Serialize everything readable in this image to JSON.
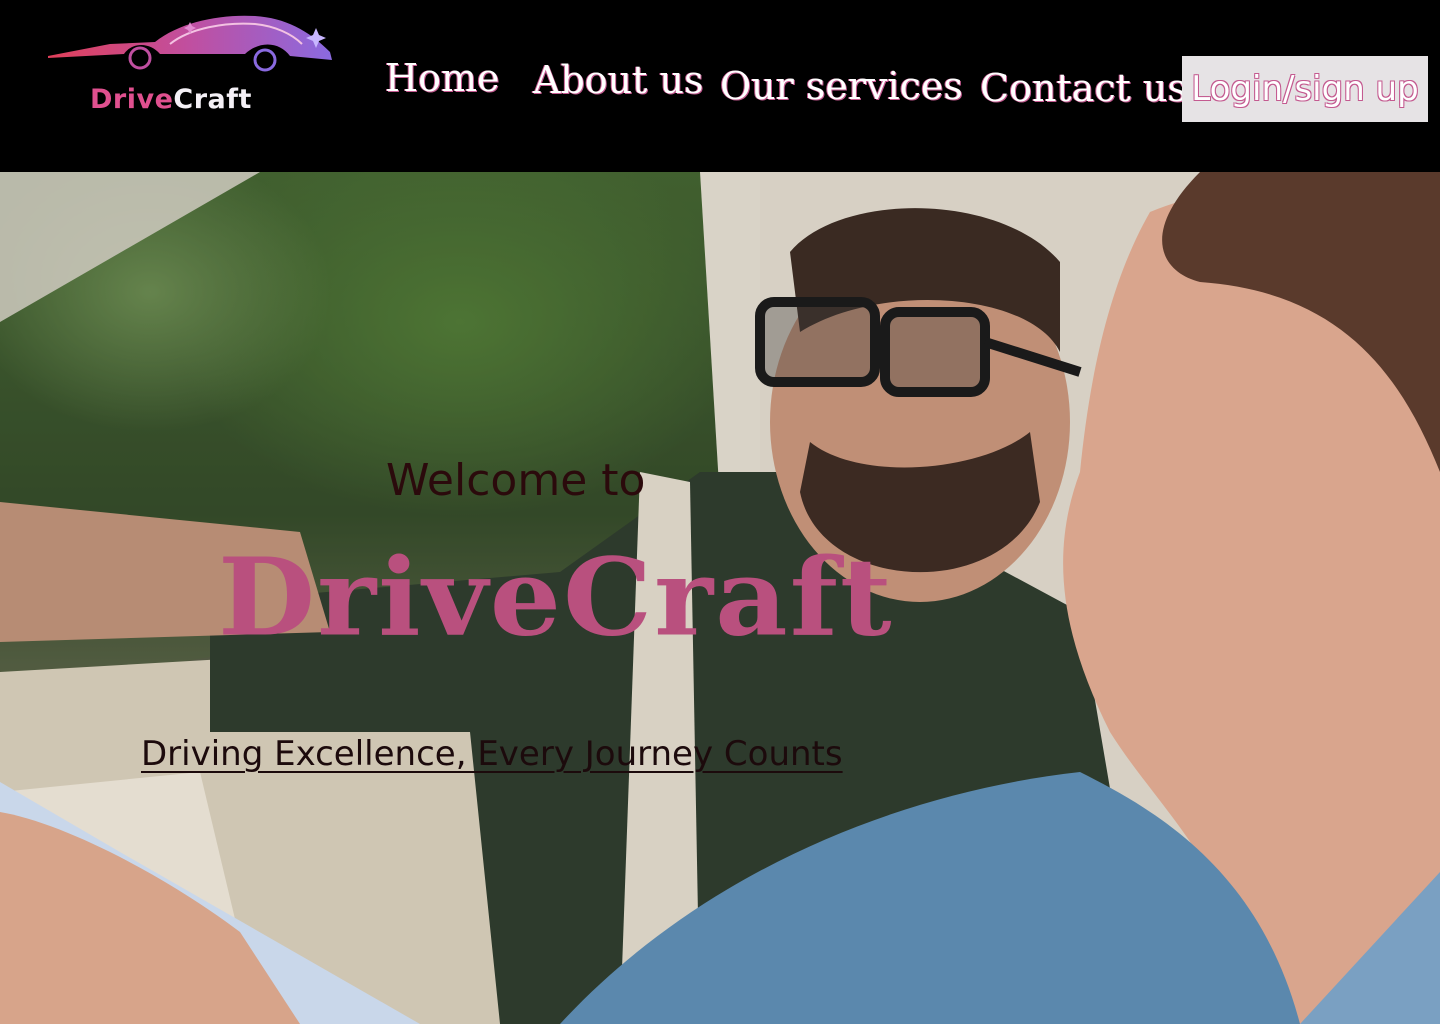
{
  "brand": {
    "logo_text_drive": "Drive",
    "logo_text_craft": "Craft"
  },
  "nav": {
    "items": [
      {
        "label": "Home"
      },
      {
        "label": "About us"
      },
      {
        "label": "Our services"
      },
      {
        "label": "Contact us"
      }
    ],
    "login_label": "Login/sign up"
  },
  "hero": {
    "welcome": "Welcome to",
    "title": "DriveCraft",
    "tagline": "Driving Excellence, Every Journey Counts"
  },
  "colors": {
    "accent_pink": "#b9507e",
    "nav_outline": "#c45a90",
    "header_bg": "#000000",
    "login_bg": "#e6e3e5"
  }
}
